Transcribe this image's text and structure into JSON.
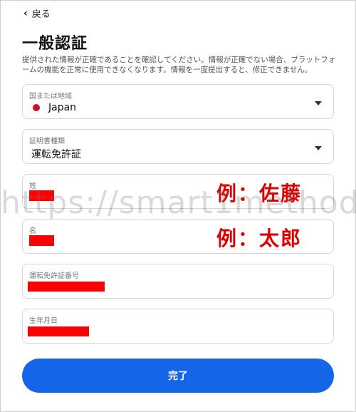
{
  "back": {
    "label": "戻る"
  },
  "page": {
    "title": "一般認証",
    "description": "提供された情報が正確であることを確認してください。情報が正確でない場合、プラットフォームの機能を正常に使用できなくなります。情報を一度提出すると、修正できません。"
  },
  "fields": {
    "country": {
      "label": "国または地域",
      "value": "Japan"
    },
    "document_type": {
      "label": "証明書種類",
      "value": "運転免許証"
    },
    "last_name": {
      "label": "姓",
      "example": "例：佐藤"
    },
    "first_name": {
      "label": "名",
      "example": "例：太郎"
    },
    "license_number": {
      "label": "運転免許証番号"
    },
    "birth_date": {
      "label": "生年月日"
    }
  },
  "watermark": "https://smart1method.com",
  "submit": {
    "label": "完了"
  },
  "colors": {
    "accent": "#1565e8",
    "redaction": "#ff0000",
    "annotation": "#d90000"
  }
}
